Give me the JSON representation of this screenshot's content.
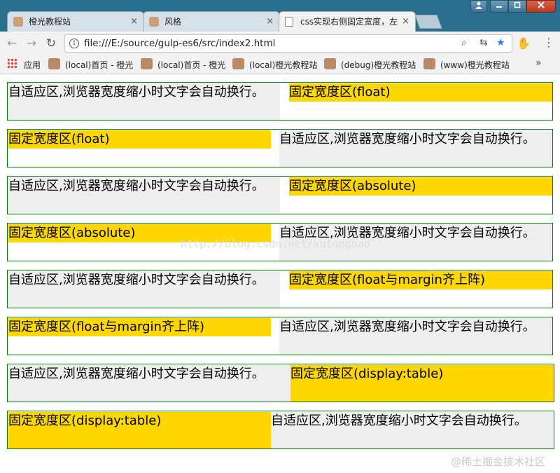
{
  "browser": {
    "tabs": [
      {
        "title": "橙光教程站"
      },
      {
        "title": "风格"
      },
      {
        "title": "css实现右侧固定宽度，左"
      }
    ],
    "close_glyph": "×",
    "url": "file:///E:/source/gulp-es6/src/index2.html",
    "nav": {
      "back": "←",
      "forward": "→",
      "reload": "↻"
    },
    "omnibox_icons": {
      "zoom": "⌕",
      "translate": "⇆",
      "bookmark_star": "★"
    },
    "star_color": "#3b78e7",
    "bookmarks": [
      {
        "label": "应用"
      },
      {
        "label": "(local)首页 - 橙光"
      },
      {
        "label": "(local)首页 - 橙光"
      },
      {
        "label": "(local)橙光教程站"
      },
      {
        "label": "(debug)橙光教程站"
      },
      {
        "label": "(www)橙光教程站"
      }
    ],
    "bookmarks_more": "»",
    "extension_icon": "✋",
    "menu_icon": "⋮"
  },
  "page": {
    "colors": {
      "fixed_bg": "#ffd700",
      "fluid_bg": "#eeeeee",
      "border": "#008000"
    },
    "demos": [
      {
        "fluid": "自适应区,浏览器宽度缩小时文字会自动换行。",
        "fixed": "固定宽度区(float)"
      },
      {
        "fixed": "固定宽度区(float)",
        "fluid": "自适应区,浏览器宽度缩小时文字会自动换行。"
      },
      {
        "fluid": "自适应区,浏览器宽度缩小时文字会自动换行。",
        "fixed": "固定宽度区(absolute)"
      },
      {
        "fixed": "固定宽度区(absolute)",
        "fluid": "自适应区,浏览器宽度缩小时文字会自动换行。"
      },
      {
        "fluid": "自适应区,浏览器宽度缩小时文字会自动换行。",
        "fixed": "固定宽度区(float与margin齐上阵)"
      },
      {
        "fixed": "固定宽度区(float与margin齐上阵)",
        "fluid": "自适应区,浏览器宽度缩小时文字会自动换行。"
      },
      {
        "fluid": "自适应区,浏览器宽度缩小时文字会自动换行。",
        "fixed": "固定宽度区(display:table)"
      },
      {
        "fixed": "固定宽度区(display:table)",
        "fluid": "自适应区,浏览器宽度缩小时文字会自动换行。"
      }
    ],
    "watermark": "http://blog.csdn.net/xutongbao",
    "footer_watermark": "@稀土掘金技术社区"
  }
}
